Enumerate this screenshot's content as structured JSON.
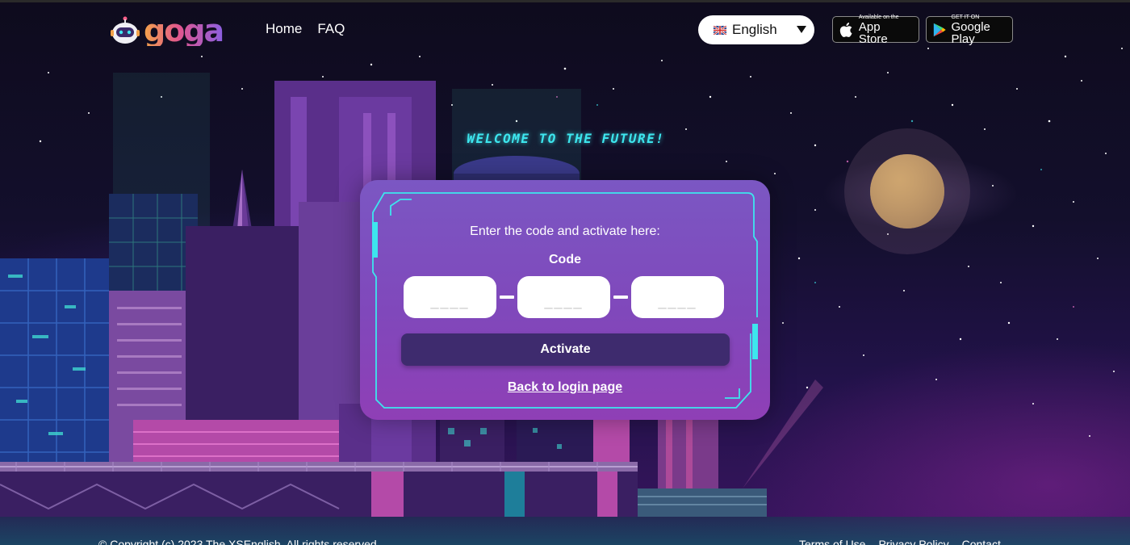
{
  "header": {
    "logo_text": "goga",
    "nav": [
      {
        "label": "Home"
      },
      {
        "label": "FAQ"
      }
    ],
    "language": {
      "selected": "English",
      "flag": "uk-flag-icon"
    },
    "app_store": {
      "small": "Available on the",
      "big": "App Store"
    },
    "google_play": {
      "small": "GET IT ON",
      "big": "Google Play"
    }
  },
  "hero": {
    "welcome": "WELCOME TO THE FUTURE!"
  },
  "activation": {
    "prompt": "Enter the code and activate here:",
    "code_label": "Code",
    "code_fields": [
      {
        "value": "",
        "placeholder": "____"
      },
      {
        "value": "",
        "placeholder": "____"
      },
      {
        "value": "",
        "placeholder": "____"
      }
    ],
    "activate_label": "Activate",
    "back_link": "Back to login page"
  },
  "footer": {
    "copyright": "© Copyright (c) 2023 The XSEnglish. All rights reserved.",
    "links": [
      "Terms of Use",
      "Privacy Policy",
      "Contact"
    ]
  },
  "colors": {
    "accent_cyan": "#3de6ee",
    "card_purple": "#7b57c3",
    "button_dark": "#3e2b6e"
  }
}
